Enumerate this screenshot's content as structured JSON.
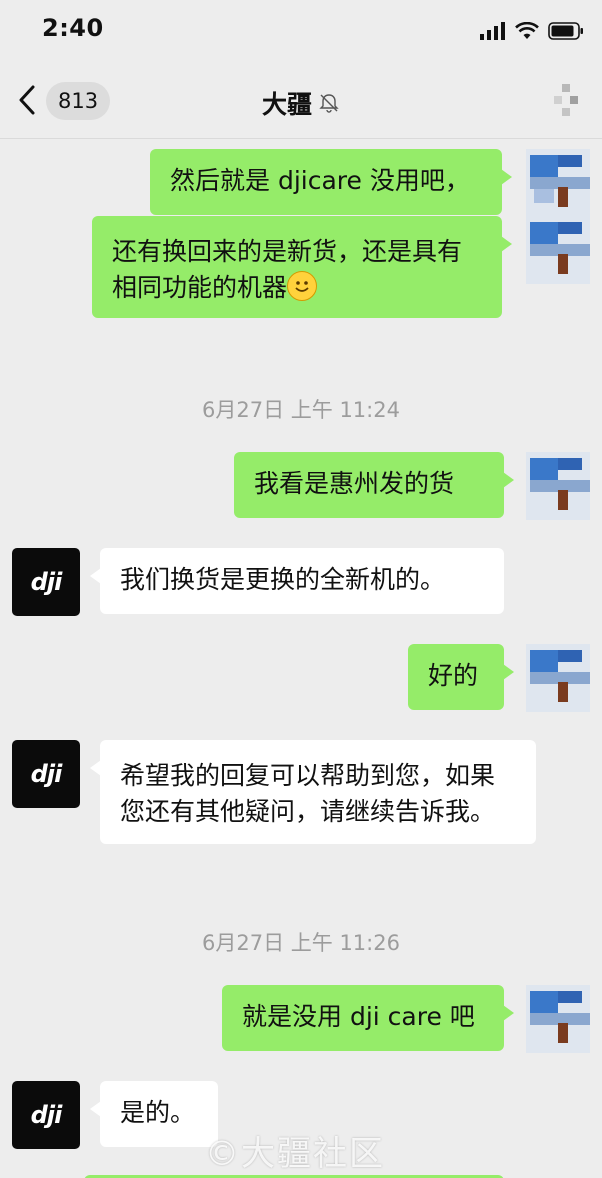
{
  "status_bar": {
    "time": "2:40"
  },
  "nav": {
    "unread_count": "813",
    "title": "大疆"
  },
  "dji_logo_text": "dji",
  "messages": [
    {
      "text": "然后就是 djicare 没用吧，"
    },
    {
      "text": "还有换回来的是新货，还是具有相同功能的机器"
    },
    {
      "time": "6月27日 上午 11:24"
    },
    {
      "text": "我看是惠州发的货"
    },
    {
      "text": "我们换货是更换的全新机的。"
    },
    {
      "text": "好的"
    },
    {
      "text": "希望我的回复可以帮助到您，如果您还有其他疑问，请继续告诉我。"
    },
    {
      "time": "6月27日 上午 11:26"
    },
    {
      "text": "就是没用 dji care 吧"
    },
    {
      "text": "是的。"
    }
  ],
  "watermark": "©大疆社区"
}
